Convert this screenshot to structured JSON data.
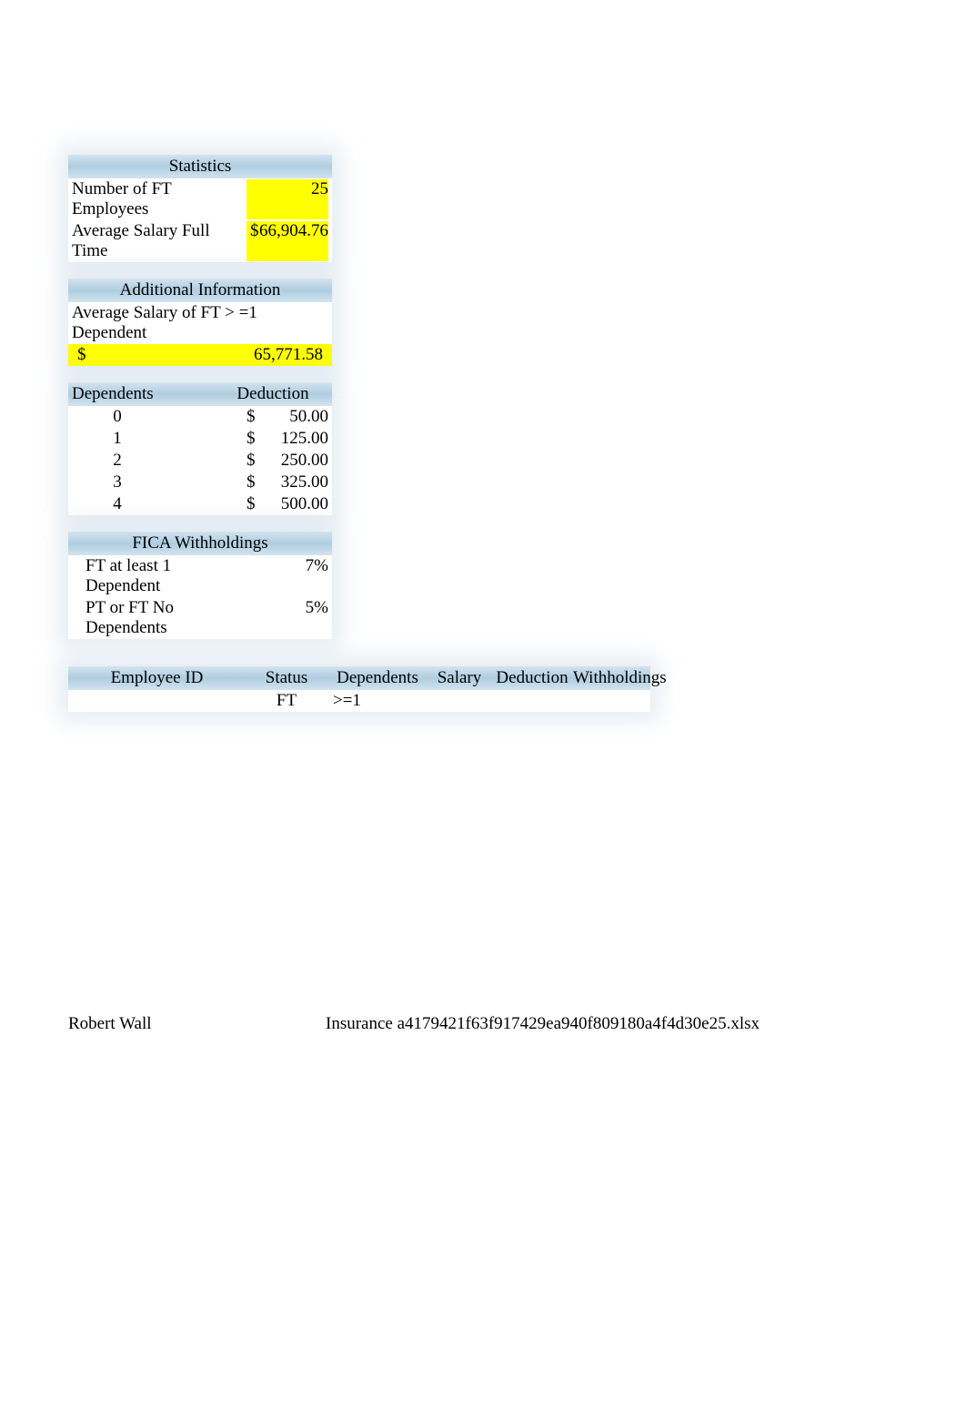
{
  "statistics": {
    "title": "Statistics",
    "rows": [
      {
        "label": "Number of FT Employees",
        "value": "25"
      },
      {
        "label": "Average Salary Full Time",
        "symbol": "$",
        "value": "66,904.76"
      }
    ]
  },
  "additional": {
    "title": "Additional Information",
    "label": "Average Salary of FT > =1 Dependent",
    "symbol": "$",
    "value": "65,771.58"
  },
  "dependents": {
    "header_left": "Dependents",
    "header_right": "Deduction",
    "rows": [
      {
        "dep": "0",
        "symbol": "$",
        "amount": "50.00"
      },
      {
        "dep": "1",
        "symbol": "$",
        "amount": "125.00"
      },
      {
        "dep": "2",
        "symbol": "$",
        "amount": "250.00"
      },
      {
        "dep": "3",
        "symbol": "$",
        "amount": "325.00"
      },
      {
        "dep": "4",
        "symbol": "$",
        "amount": "500.00"
      }
    ]
  },
  "fica": {
    "title": "FICA Withholdings",
    "rows": [
      {
        "label": "FT at least 1 Dependent",
        "value": "7%"
      },
      {
        "label": "PT or FT No Dependents",
        "value": "5%"
      }
    ]
  },
  "employee": {
    "headers": {
      "id": "Employee ID",
      "status": "Status",
      "dependents": "Dependents",
      "salary": "Salary",
      "deduction": "Deduction",
      "withholdings": "Withholdings"
    },
    "row": {
      "status": "FT",
      "dependents": ">=1"
    }
  },
  "footer": {
    "author": "Robert Wall",
    "filename": "Insurance a4179421f63f917429ea940f809180a4f4d30e25.xlsx"
  }
}
